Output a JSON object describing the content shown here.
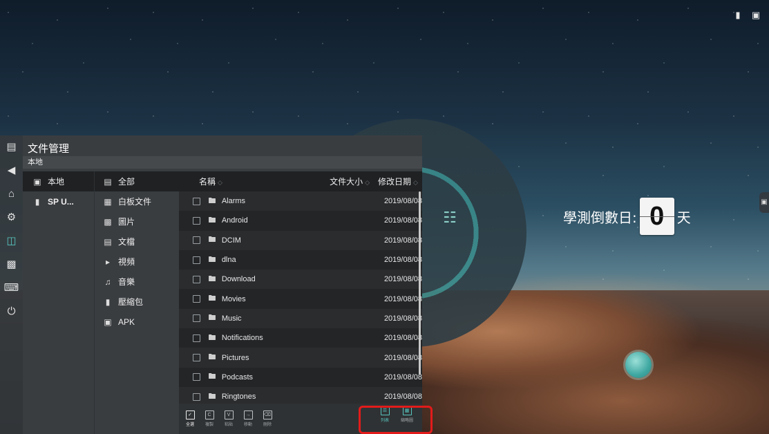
{
  "top_icons": [
    "usb-icon",
    "screen-icon"
  ],
  "countdown": {
    "label": "學測倒數日:",
    "digit": "0",
    "unit": "天"
  },
  "sidebar_strip": [
    "window-icon",
    "back-icon",
    "home-icon",
    "settings-icon",
    "folder-icon",
    "input-icon",
    "keyboard-icon",
    "power-icon"
  ],
  "file_manager": {
    "title": "文件管理",
    "breadcrumb": "本地",
    "sources": [
      {
        "label": "本地",
        "icon": "monitor-icon",
        "selected": true
      },
      {
        "label": "SP U...",
        "icon": "usb-icon",
        "selected": false
      }
    ],
    "categories": [
      {
        "label": "全部",
        "icon": "all-files-icon",
        "selected": true
      },
      {
        "label": "白板文件",
        "icon": "whiteboard-icon"
      },
      {
        "label": "圖片",
        "icon": "image-icon"
      },
      {
        "label": "文檔",
        "icon": "document-icon"
      },
      {
        "label": "視頻",
        "icon": "video-icon"
      },
      {
        "label": "音樂",
        "icon": "music-icon"
      },
      {
        "label": "壓縮包",
        "icon": "archive-icon"
      },
      {
        "label": "APK",
        "icon": "apk-icon"
      }
    ],
    "columns": {
      "name": "名稱",
      "size": "文件大小",
      "date": "修改日期"
    },
    "rows": [
      {
        "name": "Alarms",
        "size": "",
        "date": "2019/08/08"
      },
      {
        "name": "Android",
        "size": "",
        "date": "2019/08/08"
      },
      {
        "name": "DCIM",
        "size": "",
        "date": "2019/08/08"
      },
      {
        "name": "dlna",
        "size": "",
        "date": "2019/08/08"
      },
      {
        "name": "Download",
        "size": "",
        "date": "2019/08/08"
      },
      {
        "name": "Movies",
        "size": "",
        "date": "2019/08/08"
      },
      {
        "name": "Music",
        "size": "",
        "date": "2019/08/08"
      },
      {
        "name": "Notifications",
        "size": "",
        "date": "2019/08/08"
      },
      {
        "name": "Pictures",
        "size": "",
        "date": "2019/08/08"
      },
      {
        "name": "Podcasts",
        "size": "",
        "date": "2019/08/08"
      },
      {
        "name": "Ringtones",
        "size": "",
        "date": "2019/08/08"
      }
    ],
    "toolbar": {
      "select_all": "全選",
      "copy": "複製",
      "paste": "粘貼",
      "move": "移動",
      "delete": "刪除",
      "list_view": "列表",
      "thumb_view": "縮略圖"
    }
  },
  "colors": {
    "accent": "#58c6c0",
    "highlight_box": "#e31b1b"
  }
}
